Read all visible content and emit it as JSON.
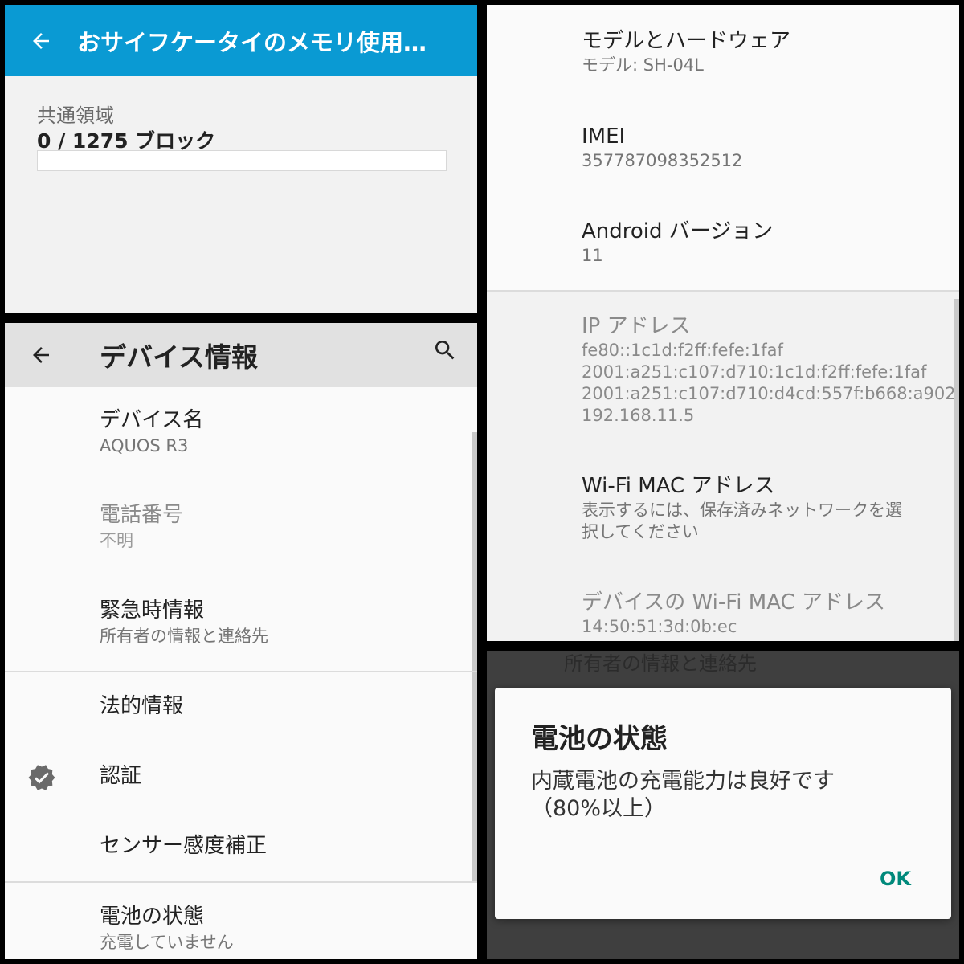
{
  "memory": {
    "title": "おサイフケータイのメモリ使用…",
    "region_label": "共通領域",
    "usage_text": "0 / 1275 ブロック",
    "used_fraction": 0,
    "accent": "#0a9ad3"
  },
  "device": {
    "title": "デバイス情報",
    "items": [
      {
        "title": "デバイス名",
        "subtitle": "AQUOS R3"
      },
      {
        "title": "電話番号",
        "subtitle": "不明"
      },
      {
        "title": "緊急時情報",
        "subtitle": "所有者の情報と連絡先"
      },
      {
        "title": "法的情報"
      },
      {
        "title": "認証",
        "icon": "verified-badge-icon"
      },
      {
        "title": "センサー感度補正"
      },
      {
        "title": "電池の状態",
        "subtitle": "充電していません"
      }
    ]
  },
  "details": {
    "items": [
      {
        "title": "モデルとハードウェア",
        "subtitle": "モデル: SH-04L"
      },
      {
        "title": "IMEI",
        "subtitle": "357787098352512"
      },
      {
        "title": "Android バージョン",
        "subtitle": "11"
      },
      {
        "title": "IP アドレス",
        "subtitle": "fe80::1c1d:f2ff:fefe:1faf\n2001:a251:c107:d710:1c1d:f2ff:fefe:1faf\n2001:a251:c107:d710:d4cd:557f:b668:a902\n192.168.11.5"
      },
      {
        "title": "Wi-Fi MAC アドレス",
        "subtitle": "表示するには、保存済みネットワークを選\n択してください"
      },
      {
        "title": "デバイスの Wi-Fi MAC アドレス",
        "subtitle": "14:50:51:3d:0b:ec"
      }
    ]
  },
  "battery_dialog": {
    "background_text": "所有者の情報と連絡先",
    "title": "電池の状態",
    "message": "内蔵電池の充電能力は良好です\n（80%以上）",
    "ok_label": "OK",
    "ok_color": "#00897b"
  }
}
